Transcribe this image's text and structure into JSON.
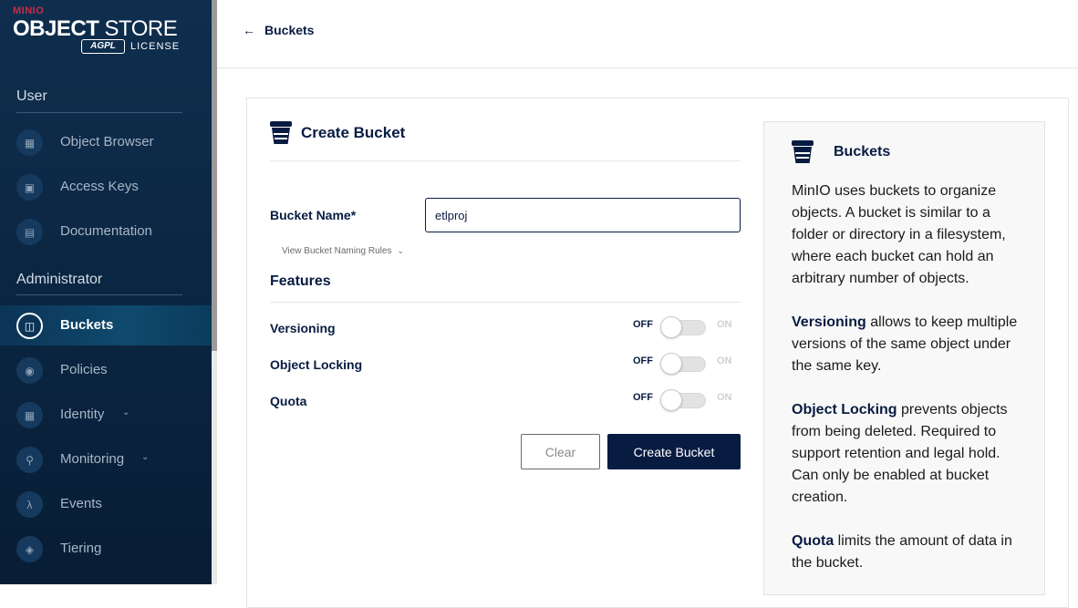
{
  "logo": {
    "small": "MINIO",
    "title_bold": "OBJECT",
    "title_regular": "STORE",
    "agpl": "AGPL",
    "license": "LICENSE"
  },
  "sidebar": {
    "user_section": "User",
    "admin_section": "Administrator",
    "user_items": [
      {
        "label": "Object Browser",
        "icon": "object-browser-icon"
      },
      {
        "label": "Access Keys",
        "icon": "access-keys-icon"
      },
      {
        "label": "Documentation",
        "icon": "documentation-icon"
      }
    ],
    "admin_items": [
      {
        "label": "Buckets",
        "icon": "buckets-icon",
        "active": true
      },
      {
        "label": "Policies",
        "icon": "policies-icon"
      },
      {
        "label": "Identity",
        "icon": "identity-icon",
        "expandable": true
      },
      {
        "label": "Monitoring",
        "icon": "monitoring-icon",
        "expandable": true
      },
      {
        "label": "Events",
        "icon": "events-icon"
      },
      {
        "label": "Tiering",
        "icon": "tiering-icon"
      }
    ]
  },
  "header": {
    "back_label": "Buckets"
  },
  "form": {
    "title": "Create Bucket",
    "bucket_name_label": "Bucket Name*",
    "bucket_name_value": "etlproj",
    "naming_rules": "View Bucket Naming Rules",
    "features_title": "Features",
    "toggles": [
      {
        "label": "Versioning",
        "off": "OFF",
        "on": "ON",
        "state": "off"
      },
      {
        "label": "Object Locking",
        "off": "OFF",
        "on": "ON",
        "state": "off"
      },
      {
        "label": "Quota",
        "off": "OFF",
        "on": "ON",
        "state": "off"
      }
    ],
    "clear_label": "Clear",
    "create_label": "Create Bucket"
  },
  "help": {
    "title": "Buckets",
    "intro": "MinIO uses buckets to organize objects. A bucket is similar to a folder or directory in a filesystem, where each bucket can hold an arbitrary number of objects.",
    "versioning_term": "Versioning",
    "versioning_text": " allows to keep multiple versions of the same object under the same key.",
    "locking_term": "Object Locking",
    "locking_text": " prevents objects from being deleted. Required to support retention and legal hold. Can only be enabled at bucket creation.",
    "quota_term": "Quota",
    "quota_text": " limits the amount of data in the bucket."
  },
  "colors": {
    "sidebar_bg": "#0f2e4e",
    "primary": "#081c42",
    "accent_red": "#c72c48"
  }
}
